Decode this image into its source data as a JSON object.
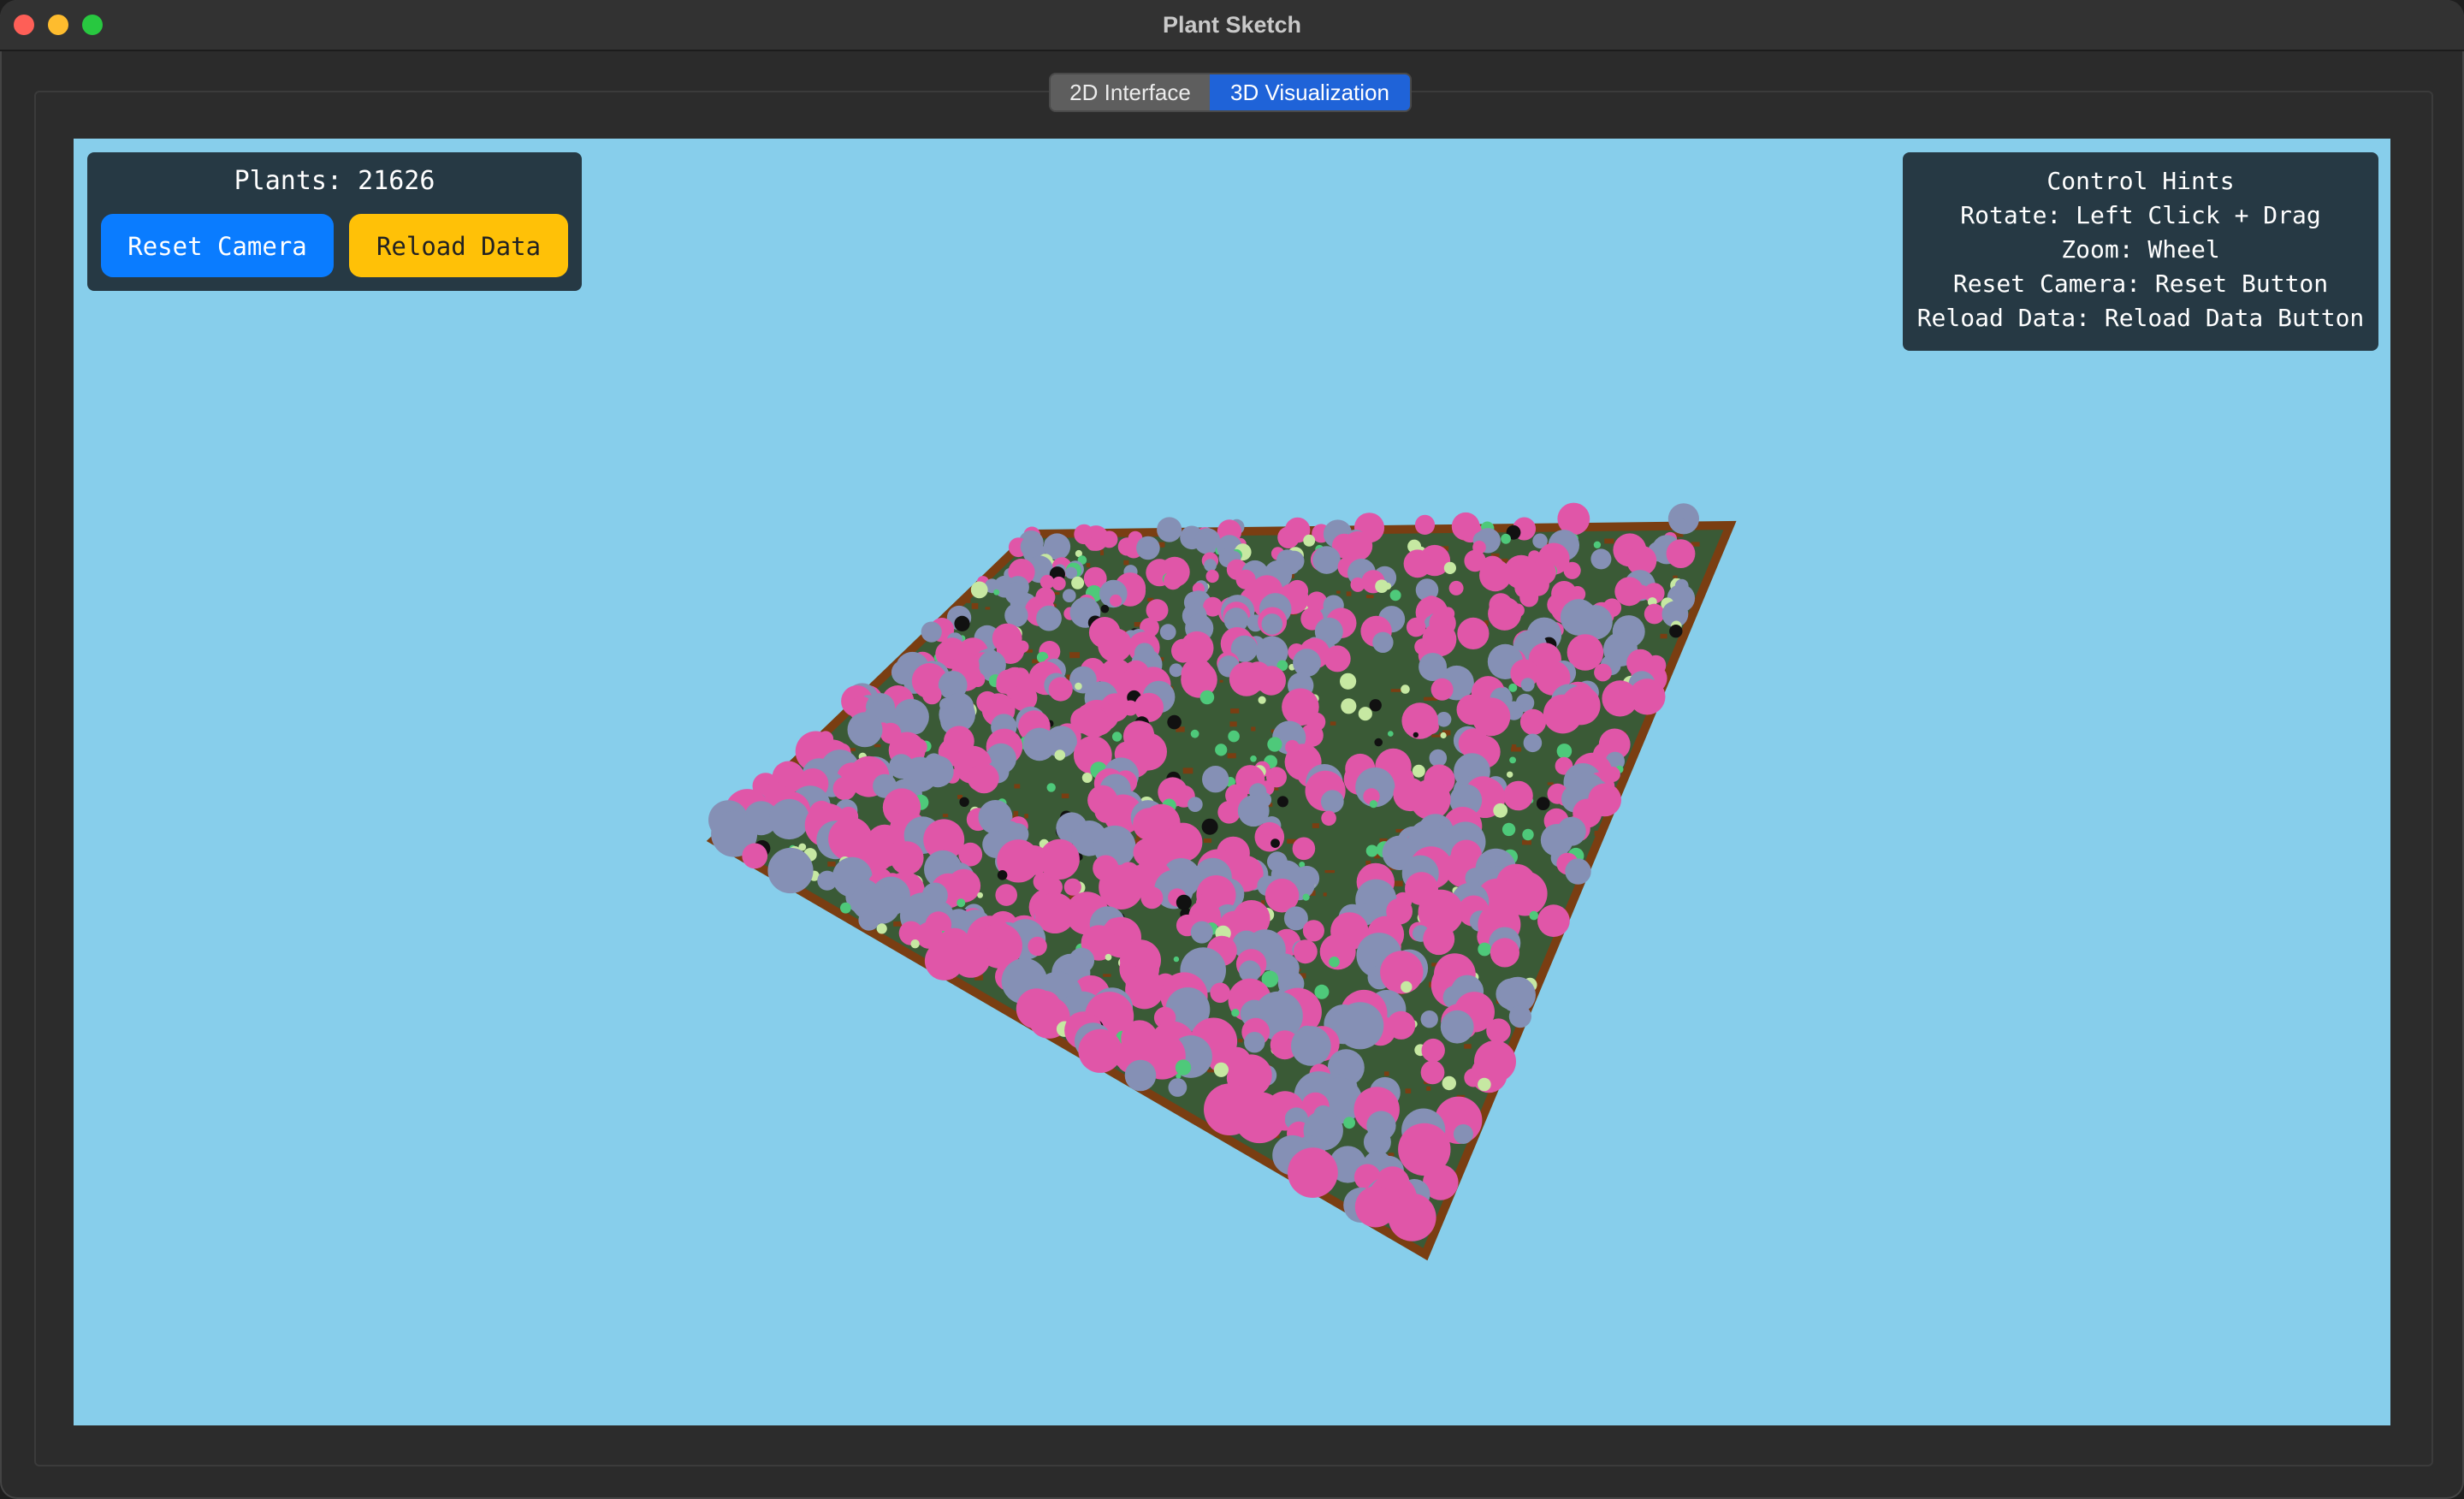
{
  "window": {
    "title": "Plant Sketch"
  },
  "tabs": [
    {
      "label": "2D Interface",
      "active": false
    },
    {
      "label": "3D Visualization",
      "active": true
    }
  ],
  "info": {
    "plants_label": "Plants: 21626",
    "reset_button": "Reset Camera",
    "reload_button": "Reload Data"
  },
  "hints": {
    "title": "Control Hints",
    "lines": [
      "Rotate: Left Click + Drag",
      "Zoom: Wheel",
      "Reset Camera: Reset Button",
      "Reload Data: Reload Data Button"
    ]
  },
  "colors": {
    "sky": "#87ceeb",
    "ground": "#3a5a36",
    "soil": "#7a3e12",
    "plant_pink": "#e056a8",
    "plant_slate": "#8590b5",
    "plant_green": "#4ec97a",
    "plant_light": "#c6e8a2",
    "plant_dark": "#111111",
    "accent_blue": "#0a7cff",
    "accent_yellow": "#ffc107"
  }
}
